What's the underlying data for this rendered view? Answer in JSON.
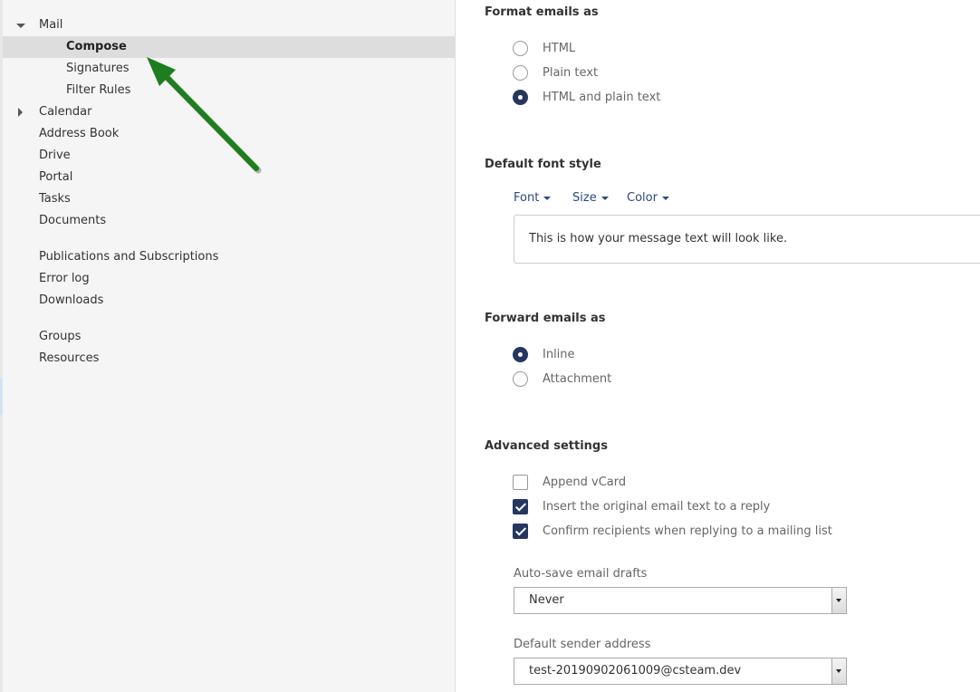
{
  "sidebar": {
    "items": [
      {
        "label": "Mail",
        "expanded": true
      },
      {
        "label": "Compose",
        "selected": true
      },
      {
        "label": "Signatures"
      },
      {
        "label": "Filter Rules"
      },
      {
        "label": "Calendar",
        "expanded": false
      },
      {
        "label": "Address Book"
      },
      {
        "label": "Drive"
      },
      {
        "label": "Portal"
      },
      {
        "label": "Tasks"
      },
      {
        "label": "Documents"
      },
      {
        "label": "Publications and Subscriptions"
      },
      {
        "label": "Error log"
      },
      {
        "label": "Downloads"
      },
      {
        "label": "Groups"
      },
      {
        "label": "Resources"
      }
    ],
    "annotation_arrow_icon": "green-arrow-icon"
  },
  "format": {
    "title": "Format emails as",
    "options": [
      {
        "label": "HTML",
        "checked": false
      },
      {
        "label": "Plain text",
        "checked": false
      },
      {
        "label": "HTML and plain text",
        "checked": true
      }
    ]
  },
  "font_style": {
    "title": "Default font style",
    "font_label": "Font",
    "size_label": "Size",
    "color_label": "Color",
    "preview_text": "This is how your message text will look like."
  },
  "forward": {
    "title": "Forward emails as",
    "options": [
      {
        "label": "Inline",
        "checked": true
      },
      {
        "label": "Attachment",
        "checked": false
      }
    ]
  },
  "advanced": {
    "title": "Advanced settings",
    "checkboxes": [
      {
        "label": "Append vCard",
        "checked": false
      },
      {
        "label": "Insert the original email text to a reply",
        "checked": true
      },
      {
        "label": "Confirm recipients when replying to a mailing list",
        "checked": true
      }
    ],
    "autosave_label": "Auto-save email drafts",
    "autosave_value": "Never",
    "sender_label": "Default sender address",
    "sender_value": "test-20190902061009@csteam.dev"
  },
  "colors": {
    "accent": "#26365f",
    "link": "#2a4a7f",
    "annotation_arrow": "#1e7d1e"
  }
}
